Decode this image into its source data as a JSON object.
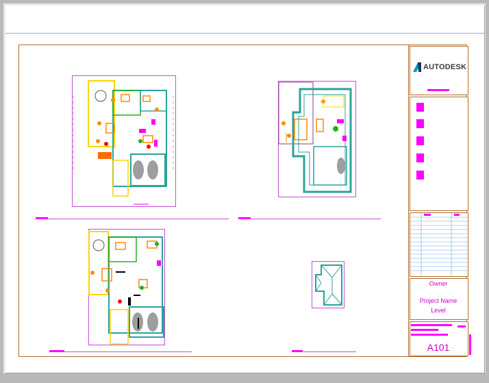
{
  "title_block": {
    "logo_text": "AUTODESK",
    "owner_label": "Owner",
    "project_name_label": "Project Name",
    "level_label": "Level",
    "sheet_number": "A101"
  },
  "colors": {
    "sheet_border": "#b36b2a",
    "annotation_magenta": "#ff00ff",
    "plan_frame": "#c24fd6",
    "wall_teal": "#2aa39a",
    "fixture_orange": "#ff8c00",
    "furniture_yellow": "#ffd400"
  },
  "drawings": [
    {
      "id": "floor-plan-1"
    },
    {
      "id": "floor-plan-2"
    },
    {
      "id": "floor-plan-3"
    },
    {
      "id": "roof-plan"
    }
  ]
}
